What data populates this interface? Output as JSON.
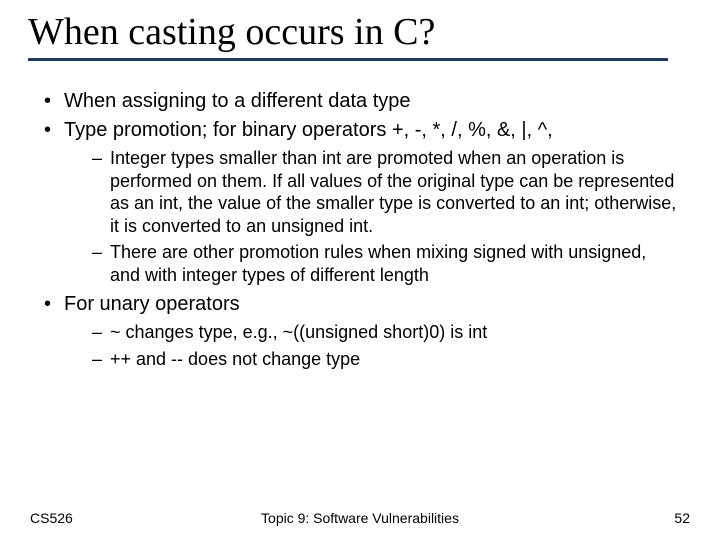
{
  "title": "When casting occurs in C?",
  "bullets": {
    "b0": "When assigning to a different data type",
    "b1": "Type promotion; for binary operators +, -, *, /, %, &, |, ^,",
    "b1_sub0": "Integer types smaller than int are promoted when an operation is performed on them. If all values of the original type can be represented as an int, the value of the smaller type is converted to an int; otherwise, it is converted to an unsigned int.",
    "b1_sub1": "There are other promotion rules when mixing signed with unsigned, and with integer types of different length",
    "b2": "For unary operators",
    "b2_sub0": "~ changes type, e.g., ~((unsigned short)0) is int",
    "b2_sub1": "++ and -- does not change type"
  },
  "footer": {
    "left": "CS526",
    "center": "Topic 9: Software Vulnerabilities",
    "page": "52"
  }
}
